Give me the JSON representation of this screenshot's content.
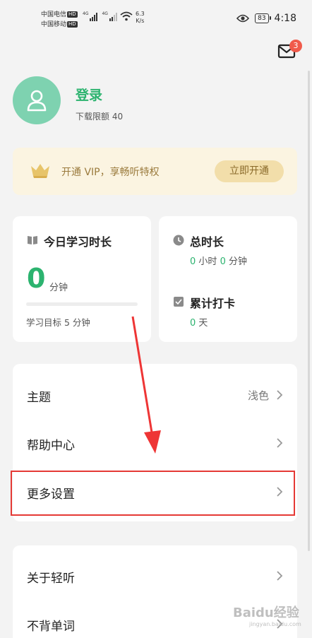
{
  "status_bar": {
    "carrier1": "中国电信",
    "carrier2": "中国移动",
    "hd_label": "HD",
    "net_type": "4G",
    "speed_value": "6.3",
    "speed_unit": "K/s",
    "battery": "83",
    "time": "4:18"
  },
  "mail": {
    "badge_count": "3",
    "icon": "mail-icon"
  },
  "profile": {
    "login_label": "登录",
    "download_quota": "下载限额 40",
    "avatar_icon": "user-icon"
  },
  "vip": {
    "text": "开通 VIP，享畅听特权",
    "button": "立即开通",
    "icon": "crown-icon"
  },
  "study_card": {
    "title": "今日学习时长",
    "minutes": "0",
    "unit": "分钟",
    "goal": "学习目标 5 分钟",
    "progress": 0
  },
  "total_card": {
    "title": "总时长",
    "hours": "0",
    "hours_unit": "小时",
    "minutes": "0",
    "minutes_unit": "分钟",
    "checkin_title": "累计打卡",
    "checkin_days": "0",
    "checkin_unit": "天"
  },
  "menu": {
    "theme_label": "主题",
    "theme_value": "浅色",
    "help_label": "帮助中心",
    "more_settings_label": "更多设置",
    "about_label": "关于轻听",
    "word_label": "不背单词"
  },
  "watermark": {
    "text": "Baidu经验",
    "sub": "jingyan.baidu.com"
  },
  "colors": {
    "accent": "#2cb36f",
    "avatar_bg": "#7ed2b0",
    "vip_bg": "#fbf4e1",
    "annotation": "#e53935"
  }
}
